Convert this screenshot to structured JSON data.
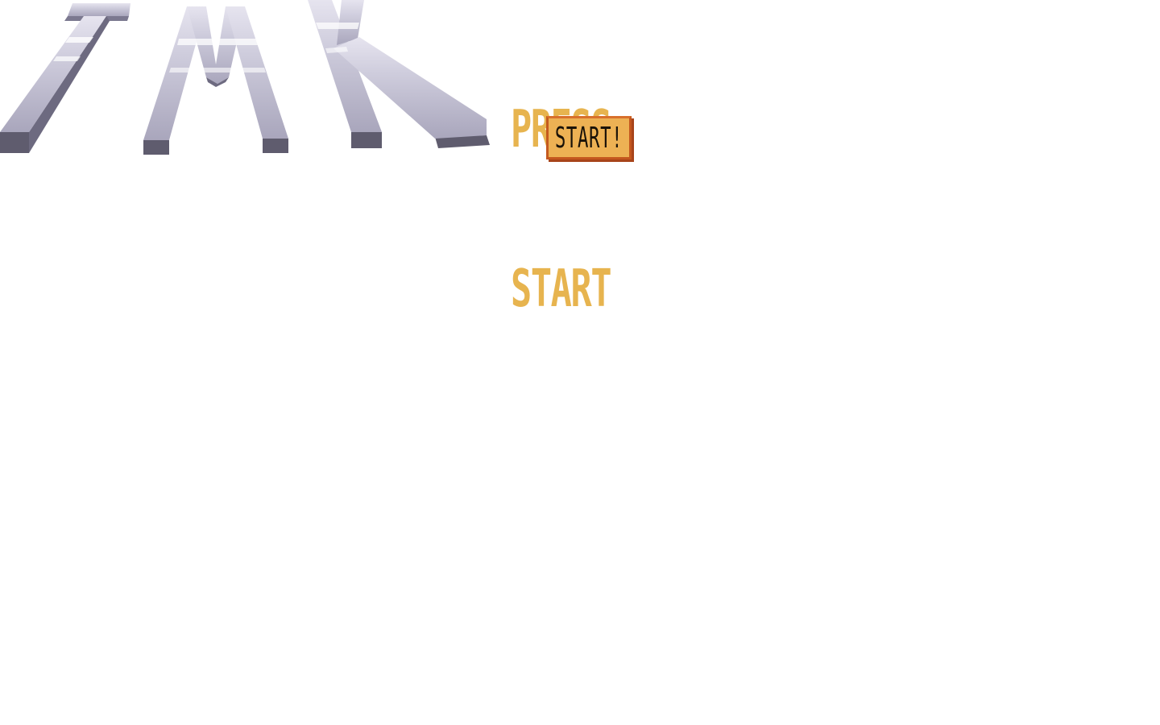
{
  "logo": {
    "letters": [
      "T",
      "M",
      "K"
    ],
    "colors": {
      "face_light": "#e6e4ef",
      "face_mid": "#b4b1c6",
      "face_shadow": "#5f5c6e",
      "stripe": "#ffffff"
    }
  },
  "title_prompt": {
    "line1": "PRESS",
    "line2": "START",
    "color": "#e7b44f"
  },
  "start_button": {
    "label": "START!",
    "fill_color": "#edb154",
    "border_color": "#c4571e"
  }
}
